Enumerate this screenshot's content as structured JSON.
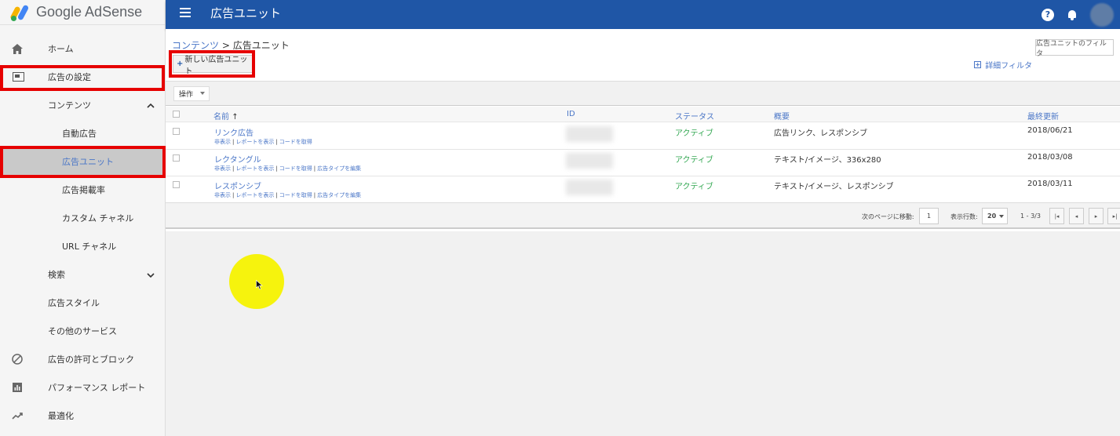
{
  "app": {
    "logo_text": "Google AdSense",
    "page_title": "広告ユニット"
  },
  "colors": {
    "topbar": "#1f56a6",
    "link": "#4a76c7",
    "active_status": "#34a853",
    "highlight_box": "#e60000",
    "cursor_highlight": "#f5f200"
  },
  "sidebar": {
    "items": [
      {
        "label": "ホーム",
        "icon": "home-icon"
      },
      {
        "label": "広告の設定",
        "icon": "ad-settings-icon"
      },
      {
        "label": "コンテンツ",
        "icon": "chevron-up-icon"
      },
      {
        "label": "自動広告"
      },
      {
        "label": "広告ユニット",
        "active": true
      },
      {
        "label": "広告掲載率"
      },
      {
        "label": "カスタム チャネル"
      },
      {
        "label": "URL チャネル"
      },
      {
        "label": "検索",
        "icon": "chevron-down-icon"
      },
      {
        "label": "広告スタイル"
      },
      {
        "label": "その他のサービス"
      },
      {
        "label": "広告の許可とブロック",
        "icon": "block-icon"
      },
      {
        "label": "パフォーマンス レポート",
        "icon": "bar-chart-icon"
      },
      {
        "label": "最適化",
        "icon": "trending-up-icon"
      }
    ]
  },
  "breadcrumb": {
    "parent": "コンテンツ",
    "separator": ">",
    "current": "広告ユニット"
  },
  "toolbar": {
    "new_button": "新しい広告ユニット",
    "filter_placeholder": "広告ユニットのフィルタ",
    "advanced_filter": "詳細フィルタ",
    "operations": "操作"
  },
  "table": {
    "headers": {
      "name": "名前",
      "id": "ID",
      "status": "ステータス",
      "summary": "概要",
      "updated": "最終更新"
    },
    "rows": [
      {
        "name": "リンク広告",
        "actions": [
          "非表示",
          "レポートを表示",
          "コードを取得"
        ],
        "status": "アクティブ",
        "summary": "広告リンク、レスポンシブ",
        "updated": "2018/06/21"
      },
      {
        "name": "レクタングル",
        "actions": [
          "非表示",
          "レポートを表示",
          "コードを取得",
          "広告タイプを編集"
        ],
        "status": "アクティブ",
        "summary": "テキスト/イメージ、336x280",
        "updated": "2018/03/08"
      },
      {
        "name": "レスポンシブ",
        "actions": [
          "非表示",
          "レポートを表示",
          "コードを取得",
          "広告タイプを編集"
        ],
        "status": "アクティブ",
        "summary": "テキスト/イメージ、レスポンシブ",
        "updated": "2018/03/11"
      }
    ]
  },
  "pager": {
    "goto_label": "次のページに移動:",
    "goto_value": "1",
    "rows_label": "表示行数:",
    "rows_value": "20",
    "range": "1 - 3/3"
  }
}
